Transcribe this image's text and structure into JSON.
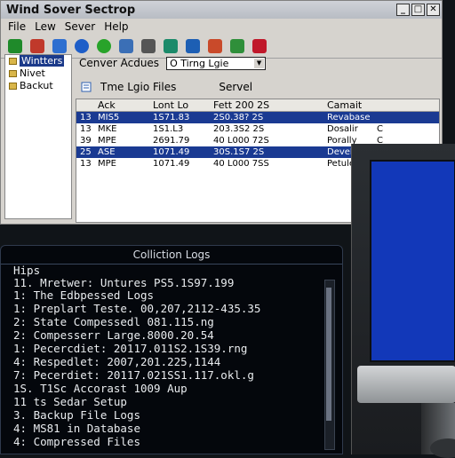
{
  "window": {
    "title": "Wind Sover Sectrop",
    "controls": [
      "_",
      "□",
      "✕"
    ]
  },
  "menu": [
    "File",
    "Lew",
    "Sever",
    "Help"
  ],
  "toolbar": {
    "icons": [
      {
        "name": "back-arrow-icon",
        "color": "#1f8a2a"
      },
      {
        "name": "edit-icon",
        "color": "#c0392b"
      },
      {
        "name": "folder-icon",
        "color": "#2e6fd0"
      },
      {
        "name": "globe-icon",
        "color": "#1e5ec8"
      },
      {
        "name": "green-orb-icon",
        "color": "#28a32a"
      },
      {
        "name": "search-icon",
        "color": "#3b6fb6"
      },
      {
        "name": "document-icon",
        "color": "#555555"
      },
      {
        "name": "save-icon",
        "color": "#1b8a6a"
      },
      {
        "name": "image-icon",
        "color": "#1d5fb4"
      },
      {
        "name": "tools-icon",
        "color": "#c94a2a"
      },
      {
        "name": "settings-icon",
        "color": "#2f8f3a"
      },
      {
        "name": "stop-icon",
        "color": "#c0182a"
      }
    ]
  },
  "tree": {
    "items": [
      {
        "label": "Wintters",
        "selected": true
      },
      {
        "label": "Nivet",
        "selected": false
      },
      {
        "label": "Backut",
        "selected": false
      }
    ]
  },
  "filter": {
    "label": "Cenver Acdues",
    "value": "O Tirng Lgie"
  },
  "subheader": {
    "left": "Tme Lgio Files",
    "right": "Servel"
  },
  "grid": {
    "headers": [
      "",
      "Ack",
      "Lont Lo",
      "Fett 200 2S",
      "",
      "Camait"
    ],
    "rows": [
      {
        "cells": [
          "13",
          "MIS5",
          "1S71.83",
          "2S0.38? 2S",
          "",
          "Revabase"
        ],
        "selected": true
      },
      {
        "cells": [
          "13",
          "MKE",
          "1S1.L3",
          "203.3S2 2S",
          "",
          "Dosalir",
          "C"
        ],
        "selected": false
      },
      {
        "cells": [
          "39",
          "MPE",
          "2691.79",
          "40 L000 72S",
          "",
          "Porally",
          "C"
        ],
        "selected": false
      },
      {
        "cells": [
          "25",
          "ASE",
          "1071.49",
          "30S.1S7 2S",
          "",
          "Devell Caner"
        ],
        "selected": true
      },
      {
        "cells": [
          "13",
          "MPE",
          "1071.49",
          "40 L000 7SS",
          "",
          "Petule",
          "C"
        ],
        "selected": false
      }
    ]
  },
  "console": {
    "title": "Colliction Logs",
    "lines": [
      "Hips",
      "11. Mretwer: Untures PS5.1S97.199",
      "    1: The Edbpessed Logs",
      "    1: Preplart Teste. 00,207,2112-435.35",
      "    2: State Compessedl 081.115.ng",
      "2: Compesserr Large.8000.20.54",
      "    1: Pecercdiet: 20117.011S2.1S39.rng",
      "    4: Respedlet: 2007,201.225,1144",
      "    7: Pecerdiet: 20117.021SS1.117.okl.g",
      "    1S. T1Sc Accorast 1009 Aup",
      "    11 ts Sedar Setup",
      "3. Backup File Logs",
      "4: MS81 in Database",
      "4: Compressed Files"
    ]
  },
  "monitor": {
    "screen_color": "#1238b9"
  }
}
